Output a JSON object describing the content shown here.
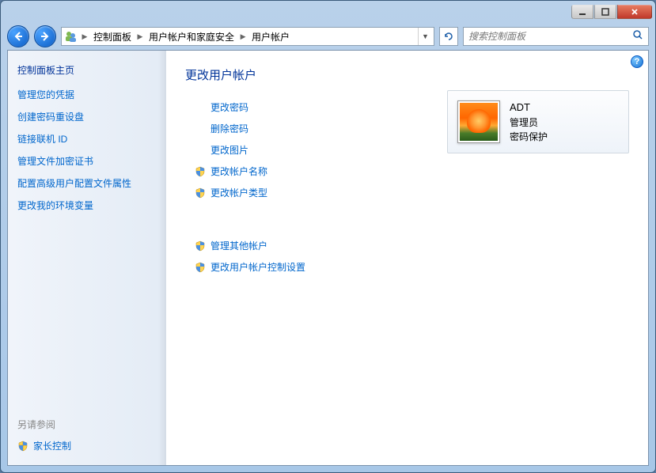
{
  "breadcrumb": {
    "items": [
      "控制面板",
      "用户帐户和家庭安全",
      "用户帐户"
    ]
  },
  "search": {
    "placeholder": "搜索控制面板"
  },
  "sidebar": {
    "title": "控制面板主页",
    "links": [
      "管理您的凭据",
      "创建密码重设盘",
      "链接联机 ID",
      "管理文件加密证书",
      "配置高级用户配置文件属性",
      "更改我的环境变量"
    ],
    "see_also_label": "另请参阅",
    "see_also_items": [
      "家长控制"
    ]
  },
  "content": {
    "title": "更改用户帐户",
    "group1": [
      {
        "label": "更改密码",
        "shield": false
      },
      {
        "label": "删除密码",
        "shield": false
      },
      {
        "label": "更改图片",
        "shield": false
      },
      {
        "label": "更改帐户名称",
        "shield": true
      },
      {
        "label": "更改帐户类型",
        "shield": true
      }
    ],
    "group2": [
      {
        "label": "管理其他帐户",
        "shield": true
      },
      {
        "label": "更改用户帐户控制设置",
        "shield": true
      }
    ]
  },
  "account": {
    "name": "ADT",
    "role": "管理员",
    "protection": "密码保护"
  }
}
